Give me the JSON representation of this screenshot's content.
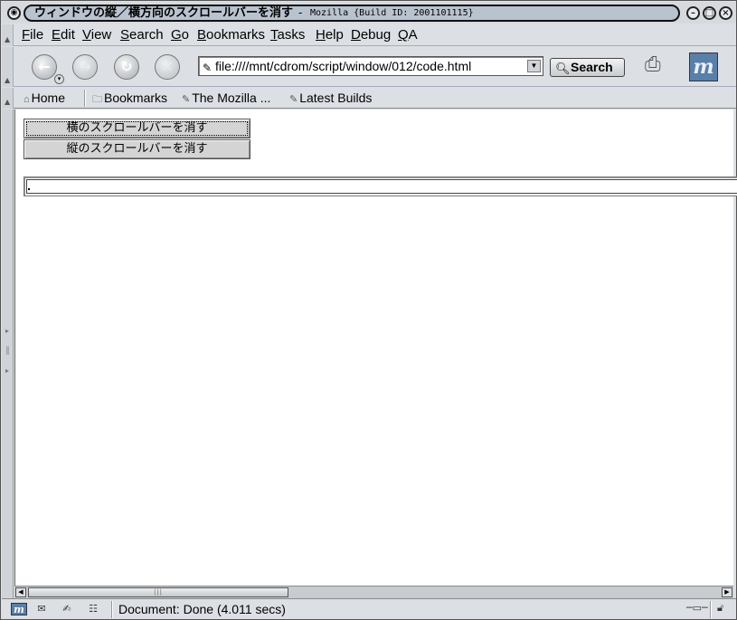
{
  "window": {
    "title_main": "ウィンドウの縦／横方向のスクロールバーを消す",
    "title_sep": "-",
    "title_app": "Mozilla {Build ID: 2001101115}",
    "minimize_glyph": "–",
    "maximize_glyph": "□",
    "close_glyph": "×"
  },
  "menubar": {
    "items": [
      {
        "label": "File"
      },
      {
        "label": "Edit"
      },
      {
        "label": "View"
      },
      {
        "label": "Search"
      },
      {
        "label": "Go"
      },
      {
        "label": "Bookmarks"
      },
      {
        "label": "Tasks"
      },
      {
        "label": "Help"
      },
      {
        "label": "Debug"
      },
      {
        "label": "QA"
      }
    ]
  },
  "navbar": {
    "back_glyph": "←",
    "forward_glyph": "→",
    "reload_glyph": "↻",
    "stop_glyph": "✕",
    "url": "file:////mnt/cdrom/script/window/012/code.html",
    "search_label": "Search",
    "logo_letter": "m"
  },
  "personalbar": {
    "home_label": "Home",
    "bookmarks_label": "Bookmarks",
    "mozilla_label": "The Mozilla ...",
    "builds_label": "Latest Builds"
  },
  "content": {
    "button_hscroll": "横のスクロールバーを消す",
    "button_vscroll": "縦のスクロールバーを消す",
    "text_field_value": ""
  },
  "statusbar": {
    "status_text": "Document: Done (4.011 secs)"
  },
  "colors": {
    "chrome": "#dce0e4",
    "title_pill": "#b9c3cf",
    "logo": "#5a7fa8"
  }
}
